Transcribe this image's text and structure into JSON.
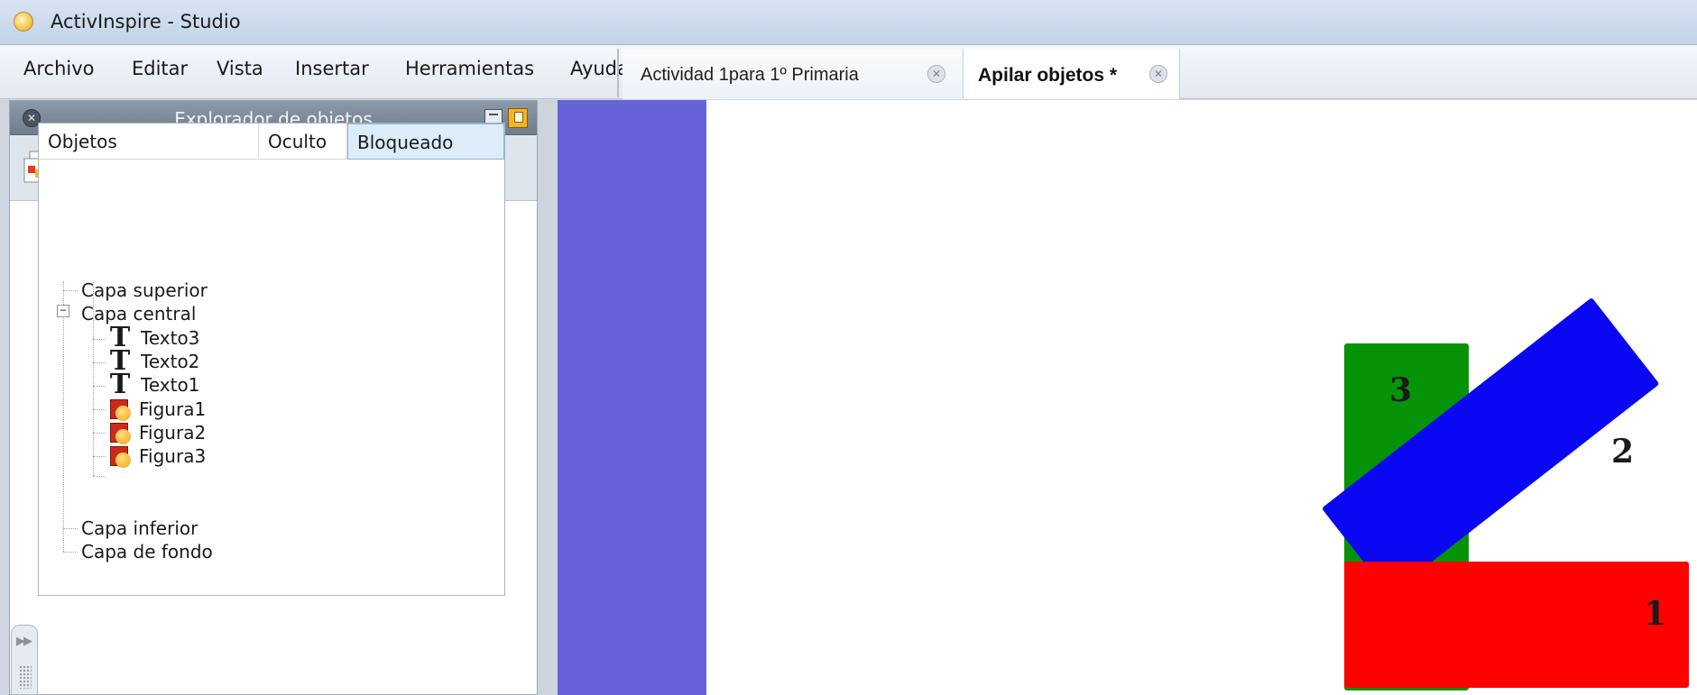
{
  "window": {
    "title": "ActivInspire - Studio"
  },
  "menu": [
    "Archivo",
    "Editar",
    "Vista",
    "Insertar",
    "Herramientas",
    "Ayuda"
  ],
  "tabs": [
    {
      "label": "Actividad 1para 1º Primaria",
      "active": false
    },
    {
      "label": "Apilar objetos *",
      "active": true
    }
  ],
  "explorer": {
    "title": "Explorador de objetos",
    "toolbar_icons": [
      "page-browser-icon",
      "resource-library-icon",
      "object-browser-icon",
      "notes-browser-icon",
      "property-browser-icon",
      "action-browser-icon",
      "voting-browser-icon"
    ],
    "columns": [
      "Objetos",
      "Oculto",
      "Bloqueado"
    ],
    "tree": [
      {
        "label": "Capa superior",
        "kind": "layer"
      },
      {
        "label": "Capa central",
        "kind": "layer",
        "expanded": true
      },
      {
        "label": "Texto3",
        "kind": "text"
      },
      {
        "label": "Texto2",
        "kind": "text"
      },
      {
        "label": "Texto1",
        "kind": "text"
      },
      {
        "label": "Figura1",
        "kind": "shape"
      },
      {
        "label": "Figura2",
        "kind": "shape"
      },
      {
        "label": "Figura3",
        "kind": "shape"
      },
      {
        "label": "Capa inferior",
        "kind": "layer"
      },
      {
        "label": "Capa de fondo",
        "kind": "layer"
      }
    ],
    "text_glyph": "T"
  },
  "canvas": {
    "shapes": [
      {
        "label": "3",
        "color": "#079307"
      },
      {
        "label": "2",
        "color": "#0a07f2"
      },
      {
        "label": "1",
        "color": "#ff0101"
      }
    ],
    "side_strip_color": "#6563d7"
  }
}
